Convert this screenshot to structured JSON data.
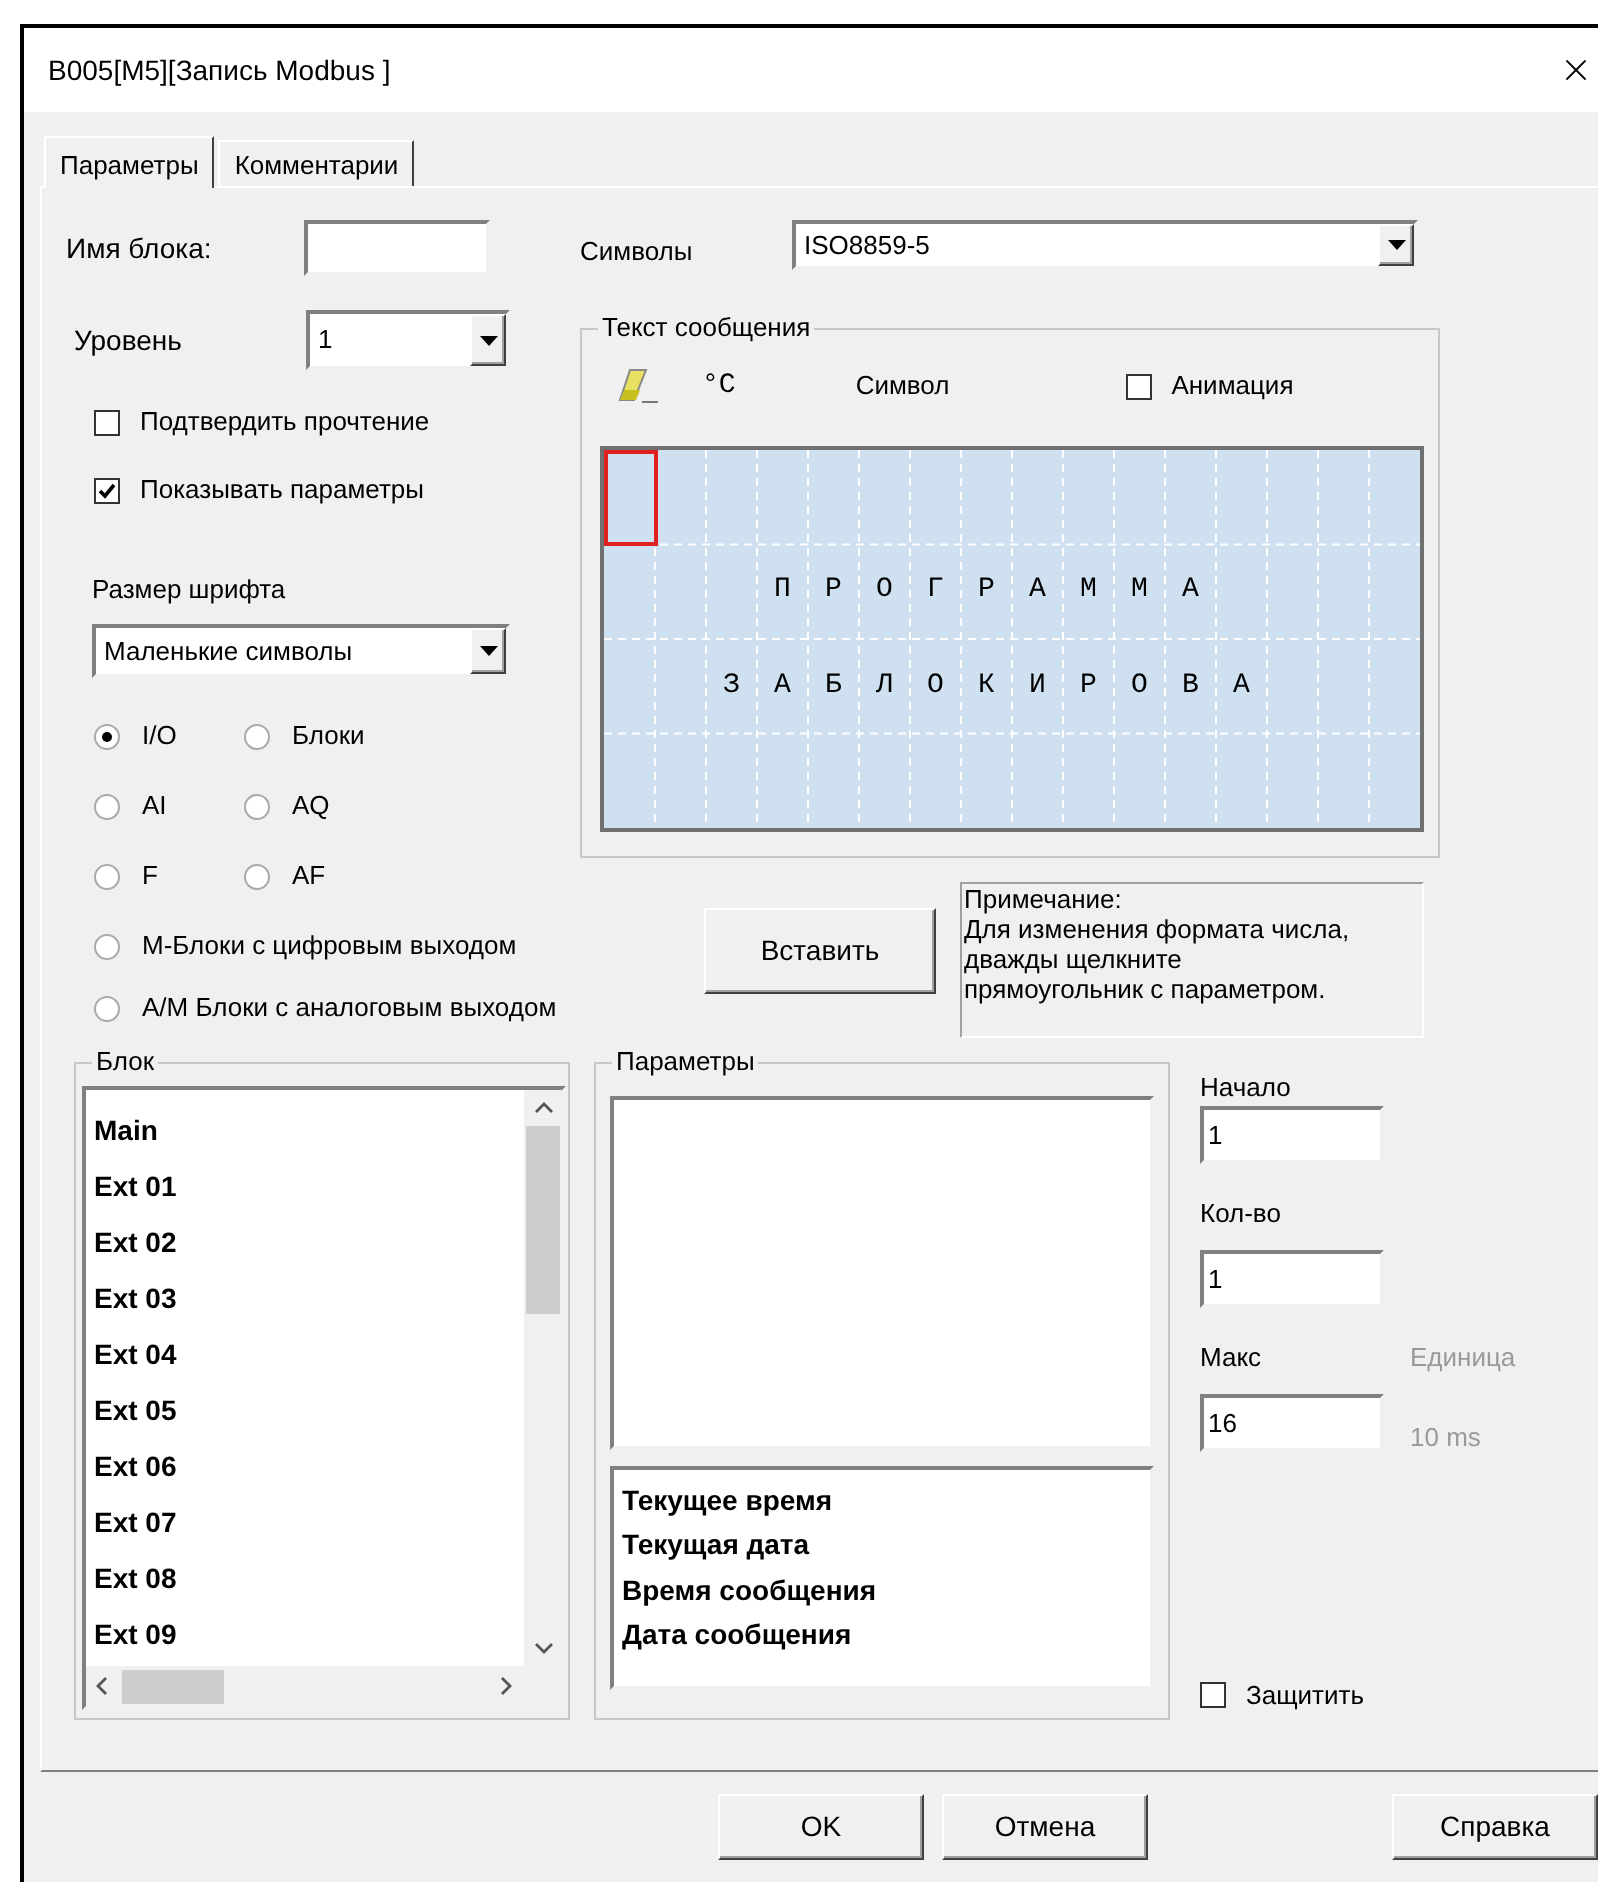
{
  "window": {
    "title": "B005[M5][Запись Modbus ]"
  },
  "tabs": [
    {
      "label": "Параметры",
      "selected": true
    },
    {
      "label": "Комментарии",
      "selected": false
    }
  ],
  "block_name": {
    "label": "Имя блока:"
  },
  "charset": {
    "label": "Символы",
    "value": "ISO8859-5"
  },
  "level": {
    "label": "Уровень",
    "value": "1"
  },
  "options": [
    {
      "label": "Подтвердить прочтение",
      "checked": false
    },
    {
      "label": "Показывать параметры",
      "checked": true
    }
  ],
  "font_size": {
    "label": "Размер шрифта",
    "value": "Маленькие символы"
  },
  "block_types": [
    {
      "label": "I/O",
      "selected": true
    },
    {
      "label": "Блоки",
      "selected": false
    },
    {
      "label": "AI",
      "selected": false
    },
    {
      "label": "AQ",
      "selected": false
    },
    {
      "label": "F",
      "selected": false
    },
    {
      "label": "AF",
      "selected": false
    }
  ],
  "output_types": [
    {
      "label": "М-Блоки с цифровым выходом",
      "selected": false
    },
    {
      "label": "А/М Блоки с аналоговым выходом",
      "selected": false
    }
  ],
  "message_text": {
    "title": "Текст сообщения",
    "degree_button": "°C",
    "symbol_label": "Символ",
    "animation": {
      "label": "Анимация",
      "checked": false
    },
    "lcd_rows": [
      {},
      {
        "text": "   ПРОГРАММА"
      },
      {
        "text": "  ЗАБЛОКИРОВА"
      },
      {}
    ]
  },
  "insert_button": "Вставить",
  "note": "Примечание:\nДля изменения формата числа,\nдважды щелкните\nпрямоугольник с параметром.",
  "block_list": {
    "title": "Блок",
    "items": [
      {
        "label": "Main",
        "selected": false
      },
      {
        "label": "Ext 01",
        "selected": false
      },
      {
        "label": "Ext 02",
        "selected": false
      },
      {
        "label": "Ext 03",
        "selected": false
      },
      {
        "label": "Ext 04",
        "selected": false
      },
      {
        "label": "Ext 05",
        "selected": false
      },
      {
        "label": "Ext 06",
        "selected": false
      },
      {
        "label": "Ext 07",
        "selected": false
      },
      {
        "label": "Ext 08",
        "selected": false
      },
      {
        "label": "Ext 09",
        "selected": false
      }
    ]
  },
  "parameters": {
    "title": "Параметры",
    "special_items": [
      {
        "label": "Текущее время",
        "selected": false
      },
      {
        "label": "Текущая дата",
        "selected": false
      },
      {
        "label": "Время сообщения",
        "selected": false
      },
      {
        "label": "Дата сообщения",
        "selected": false
      }
    ]
  },
  "start": {
    "label": "Начало",
    "value": "1"
  },
  "count": {
    "label": "Кол-во",
    "value": "1"
  },
  "max": {
    "label": "Макс",
    "value": "16"
  },
  "unit": {
    "label": "Единица",
    "value": "10 ms",
    "disabled": true
  },
  "protect": {
    "label": "Защитить",
    "checked": false
  },
  "buttons": [
    "OK",
    "Отмена",
    "Справка"
  ]
}
